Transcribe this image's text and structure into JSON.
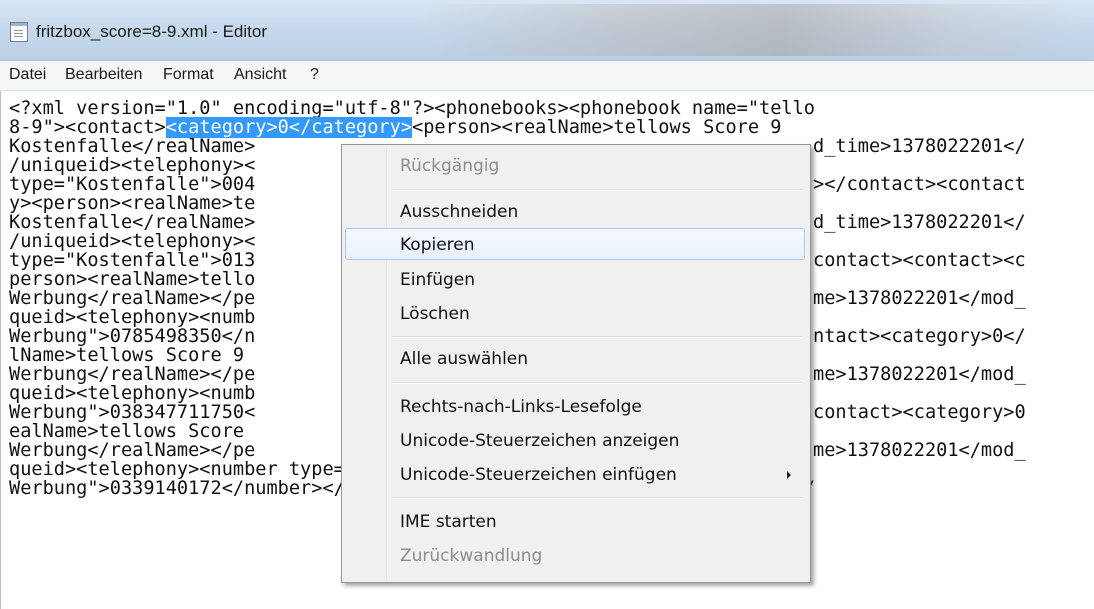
{
  "window": {
    "title": "fritzbox_score=8-9.xml - Editor",
    "icon": "notepad-icon"
  },
  "menubar": {
    "items": [
      "Datei",
      "Bearbeiten",
      "Format",
      "Ansicht",
      "?"
    ]
  },
  "editor": {
    "lines": [
      "<?xml version=\"1.0\" encoding=\"utf-8\"?><phonebooks><phonebook name=\"tello",
      "8-9\"><contact>",
      "Kostenfalle</realName>",
      "/uniqueid><telephony><",
      "type=\"Kostenfalle\">004",
      "y><person><realName>te",
      "Kostenfalle</realName>",
      "/uniqueid><telephony><",
      "type=\"Kostenfalle\">013",
      "person><realName>tello",
      "Werbung</realName></pe",
      "queid><telephony><numb",
      "Werbung\">0785498350</n",
      "lName>tellows Score 9",
      "Werbung</realName></pe",
      "queid><telephony><numb",
      "Werbung\">038347711750<",
      "ealName>tellows Score",
      "Werbung</realName></pe",
      "queid><telephony><number type=\"Aggressive",
      "Werbung\">0339140172</number></telephony></contact><contact><category>0</"
    ],
    "selected_text": "<category>0</category>",
    "line2_rest": "<person><realName>tellows Score 9",
    "right_fragments": [
      "d_time>1378022201</",
      "></contact><contact",
      "d_time>1378022201</",
      "contact><contact><c",
      "me>1378022201</mod_",
      "ntact><category>0</",
      "me>1378022201</mod_",
      "contact><category>0",
      "me>1378022201</mod_"
    ]
  },
  "context_menu": {
    "undo": "Rückgängig",
    "cut": "Ausschneiden",
    "copy": "Kopieren",
    "paste": "Einfügen",
    "delete": "Löschen",
    "select_all": "Alle auswählen",
    "rtl": "Rechts-nach-Links-Lesefolge",
    "show_unicode": "Unicode-Steuerzeichen anzeigen",
    "insert_unicode": "Unicode-Steuerzeichen einfügen",
    "ime_open": "IME starten",
    "reconversion": "Zurückwandlung"
  },
  "colors": {
    "selection": "#3399ff",
    "hover_border": "#a8c9ee",
    "disabled_text": "#8d8d8d"
  }
}
